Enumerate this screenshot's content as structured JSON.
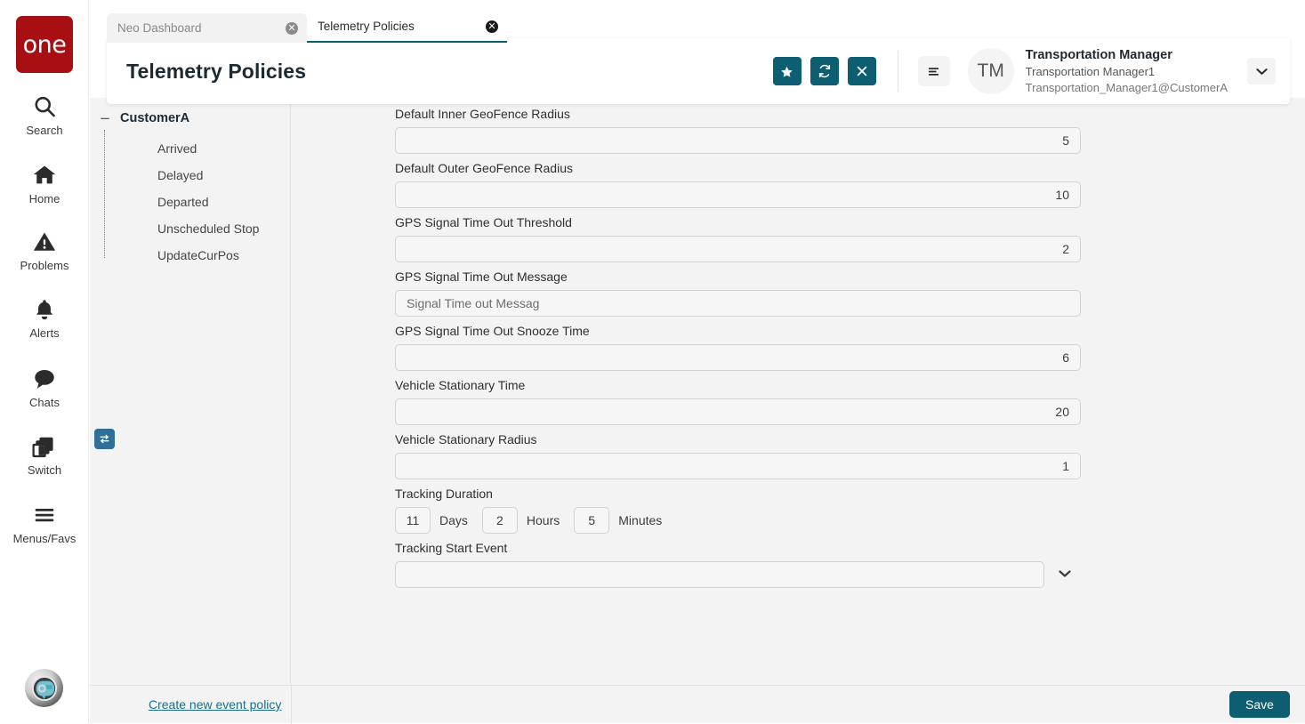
{
  "brand": {
    "logo_text": "one",
    "logo_color": "#a70f13"
  },
  "theme": {
    "accent": "#0d5e70",
    "link": "#1b6f8a",
    "switch_badge": "#2f6f98"
  },
  "rail": {
    "items": [
      {
        "label": "Search",
        "icon": "search-icon"
      },
      {
        "label": "Home",
        "icon": "home-icon"
      },
      {
        "label": "Problems",
        "icon": "warning-triangle-icon"
      },
      {
        "label": "Alerts",
        "icon": "bell-icon"
      },
      {
        "label": "Chats",
        "icon": "chat-bubble-icon"
      },
      {
        "label": "Switch",
        "icon": "switch-windows-icon",
        "badge_icon": "swap-arrows-icon"
      },
      {
        "label": "Menus/Favs",
        "icon": "hamburger-icon"
      }
    ],
    "assistant_avatar": "ai-assistant-avatar"
  },
  "tabs": [
    {
      "title": "Neo Dashboard",
      "active": false,
      "close_icon": "close-circle-icon"
    },
    {
      "title": "Telemetry Policies",
      "active": true,
      "close_icon": "close-circle-icon"
    }
  ],
  "header": {
    "title": "Telemetry Policies",
    "actions": [
      {
        "name": "favorite-button",
        "icon": "star-icon"
      },
      {
        "name": "refresh-button",
        "icon": "refresh-icon"
      },
      {
        "name": "close-button",
        "icon": "x-icon"
      }
    ],
    "menu_icon": "hamburger-menu-icon",
    "user": {
      "initials": "TM",
      "name": "Transportation Manager",
      "username": "Transportation Manager1",
      "email": "Transportation_Manager1@CustomerA"
    },
    "caret_icon": "chevron-down-icon"
  },
  "tree": {
    "toggle": "−",
    "root": "CustomerA",
    "children": [
      "Arrived",
      "Delayed",
      "Departed",
      "Unscheduled Stop",
      "UpdateCurPos"
    ]
  },
  "form": {
    "fields": [
      {
        "label": "Default Inner GeoFence Radius",
        "value": "5",
        "align": "right",
        "type": "text"
      },
      {
        "label": "Default Outer GeoFence Radius",
        "value": "10",
        "align": "right",
        "type": "text"
      },
      {
        "label": "GPS Signal Time Out Threshold",
        "value": "2",
        "align": "right",
        "type": "text"
      },
      {
        "label": "GPS Signal Time Out Message",
        "value": "Signal Time out Messag",
        "align": "left",
        "type": "text"
      },
      {
        "label": "GPS Signal Time Out Snooze Time",
        "value": "6",
        "align": "right",
        "type": "text"
      },
      {
        "label": "Vehicle Stationary Time",
        "value": "20",
        "align": "right",
        "type": "text"
      },
      {
        "label": "Vehicle Stationary Radius",
        "value": "1",
        "align": "right",
        "type": "text"
      }
    ],
    "duration": {
      "label": "Tracking Duration",
      "days": {
        "value": "11",
        "unit": "Days"
      },
      "hours": {
        "value": "2",
        "unit": "Hours"
      },
      "minutes": {
        "value": "5",
        "unit": "Minutes"
      }
    },
    "start_event": {
      "label": "Tracking Start Event",
      "value": "",
      "caret_icon": "chevron-down-icon"
    }
  },
  "footer": {
    "create_link": "Create new event policy",
    "save_label": "Save"
  }
}
